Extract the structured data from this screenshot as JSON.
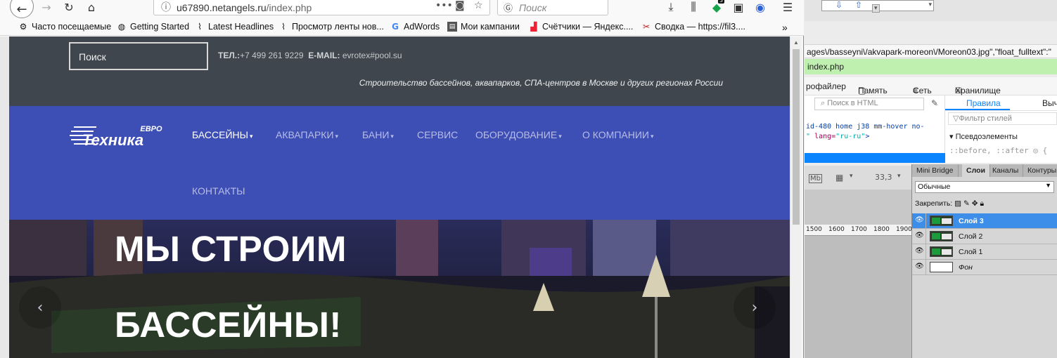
{
  "browser": {
    "url_host": "u67890.netangels.ru",
    "url_path": "/index.php",
    "search_placeholder": "Поиск",
    "badge_count": "3",
    "bookmarks": [
      {
        "label": "Часто посещаемые",
        "icon": "gear-icon"
      },
      {
        "label": "Getting Started",
        "icon": "globe-icon"
      },
      {
        "label": "Latest Headlines",
        "icon": "rss-icon"
      },
      {
        "label": "Просмотр ленты нов...",
        "icon": "rss-icon"
      },
      {
        "label": "AdWords",
        "icon": "google-icon"
      },
      {
        "label": "Мои кампании",
        "icon": "page-icon"
      },
      {
        "label": "Счётчики — Яндекс....",
        "icon": "chart-icon"
      },
      {
        "label": "Сводка — https://fil3....",
        "icon": "tools-icon"
      }
    ]
  },
  "site": {
    "search_label": "Поиск",
    "phone_label": "ТЕЛ.:",
    "phone": "+7 499 261 9229",
    "email_label": "E-MAIL:",
    "email": "evrotex#pool.su",
    "tagline": "Строительство бассейнов, аквапарков, СПА-центров в Москве и других регионах России",
    "logo_top": "ЕВРО",
    "logo_main": "Техника",
    "nav": [
      {
        "label": "БАССЕЙНЫ",
        "caret": true
      },
      {
        "label": "АКВАПАРКИ",
        "caret": true
      },
      {
        "label": "БАНИ",
        "caret": true
      },
      {
        "label": "СЕРВИС",
        "caret": false
      },
      {
        "label": "ОБОРУДОВАНИЕ",
        "caret": true
      },
      {
        "label": "О КОМПАНИИ",
        "caret": true
      },
      {
        "label": "КОНТАКТЫ",
        "caret": false
      }
    ],
    "hero_line1": "МЫ СТРОИМ",
    "hero_line2": "БАССЕЙНЫ!",
    "accent_nav": "#3d4eb5",
    "accent_top": "#3f464d"
  },
  "devtools": {
    "json_fragment": "ages\\/basseyni\\/akvapark-moreon\\/Moreon03.jpg\",\"float_fulltext\":\"",
    "green_url": "index.php",
    "tabs": [
      "рофайлер",
      "Память",
      "Сеть",
      "Хранилище"
    ],
    "html_search": "Поиск в HTML",
    "code_line1_attr": "id-480 home j38 mm-hover no-",
    "code_line2_attr": "lang=",
    "code_line2_val": "\"ru-ru\"",
    "code_line2_prefix": "\"",
    "rules_tab": "Правила",
    "computed_tab": "Выч",
    "filter_placeholder": "Фильтр стилей",
    "pseudo_heading": "Псевдоэлементы",
    "pseudo_list": "::before, ::after"
  },
  "photoshop": {
    "zoom": "33,3",
    "ruler": [
      "1500",
      "1600",
      "1700",
      "1800",
      "1900"
    ],
    "panel_tabs": [
      "Mini Bridge",
      "Слои",
      "Каналы",
      "Контуры"
    ],
    "blend_mode": "Обычные",
    "lock_label": "Закрепить:",
    "layers": [
      {
        "name": "Слой 3",
        "selected": true,
        "thumb": "image"
      },
      {
        "name": "Слой 2",
        "selected": false,
        "thumb": "image"
      },
      {
        "name": "Слой 1",
        "selected": false,
        "thumb": "image"
      },
      {
        "name": "Фон",
        "selected": false,
        "thumb": "white"
      }
    ]
  }
}
